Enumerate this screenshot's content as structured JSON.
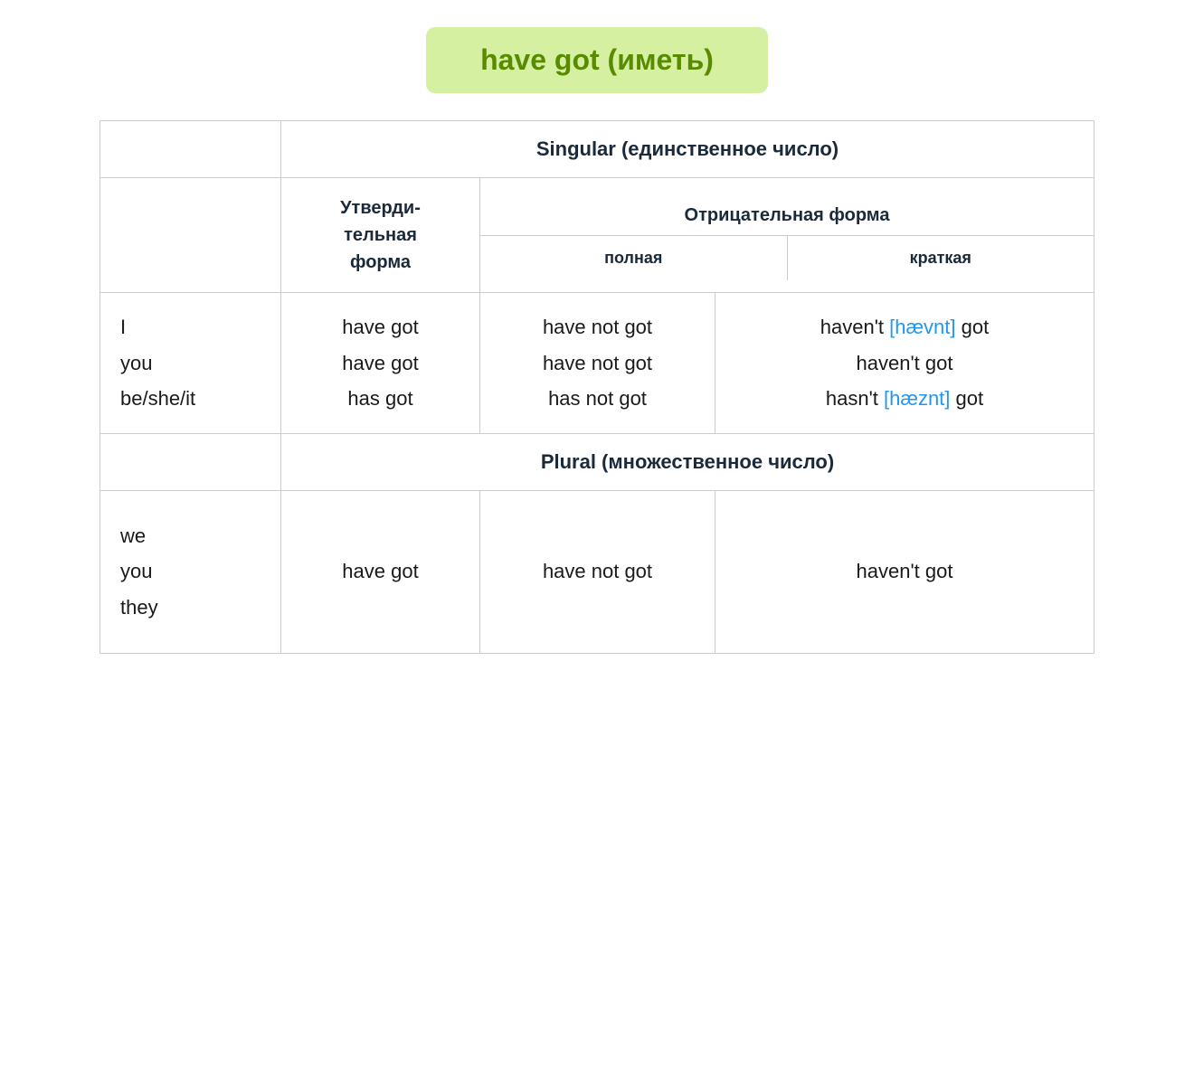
{
  "title": "have got (иметь)",
  "table": {
    "singular_header": "Singular (единственное число)",
    "plural_header": "Plural (множественное число)",
    "affirmative_header": "Утверди-\nтельная\nформа",
    "negative_header": "Отрицательная форма",
    "full_sub": "полная",
    "short_sub": "краткая",
    "singular_rows": [
      {
        "subject": "I",
        "affirmative": "have got",
        "negative_full": "have not got",
        "negative_short_prefix": "haven't ",
        "phonetic": "[hævnt]",
        "negative_short_suffix": " got"
      },
      {
        "subject": "you",
        "affirmative": "have got",
        "negative_full": "have not got",
        "negative_short": "haven't got",
        "phonetic": ""
      },
      {
        "subject": "be/she/it",
        "affirmative": "has got",
        "negative_full": "has not got",
        "negative_short_prefix": "hasn't ",
        "phonetic": "[hæznt]",
        "negative_short_suffix": " got"
      }
    ],
    "plural_rows": [
      {
        "subjects": [
          "we",
          "you",
          "they"
        ],
        "affirmative": "have got",
        "negative_full": "have not got",
        "negative_short": "haven't got"
      }
    ]
  }
}
